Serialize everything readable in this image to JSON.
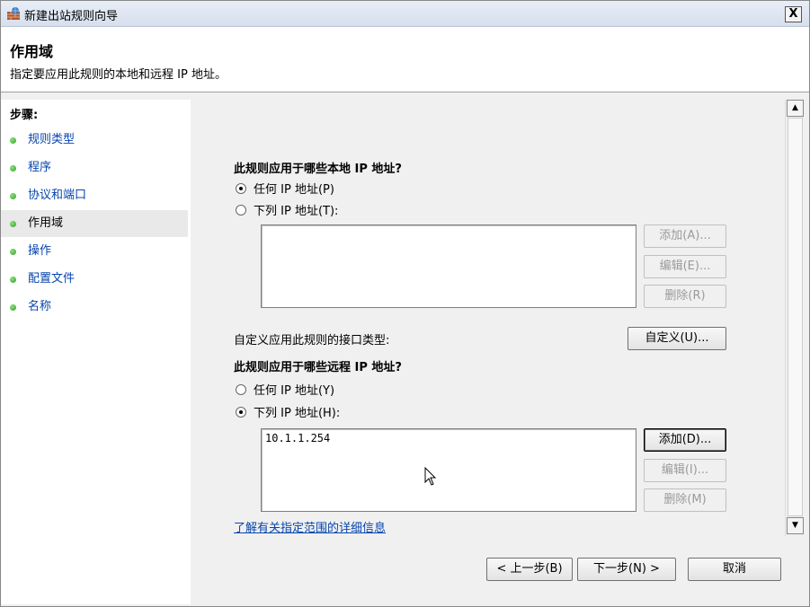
{
  "window": {
    "title": "新建出站规则向导",
    "close_label": "X"
  },
  "header": {
    "title": "作用域",
    "description": "指定要应用此规则的本地和远程 IP 地址。"
  },
  "sidebar": {
    "title": "步骤:",
    "items": [
      {
        "label": "规则类型"
      },
      {
        "label": "程序"
      },
      {
        "label": "协议和端口"
      },
      {
        "label": "作用域"
      },
      {
        "label": "操作"
      },
      {
        "label": "配置文件"
      },
      {
        "label": "名称"
      }
    ]
  },
  "local": {
    "question": "此规则应用于哪些本地 IP 地址?",
    "any_label": "任何 IP 地址(P)",
    "list_label": "下列 IP 地址(T):",
    "add_label": "添加(A)...",
    "edit_label": "编辑(E)...",
    "remove_label": "删除(R)"
  },
  "interface": {
    "label": "自定义应用此规则的接口类型:",
    "button_label": "自定义(U)..."
  },
  "remote": {
    "question": "此规则应用于哪些远程 IP 地址?",
    "any_label": "任何 IP 地址(Y)",
    "list_label": "下列 IP 地址(H):",
    "entries": [
      "10.1.1.254"
    ],
    "add_label": "添加(D)...",
    "edit_label": "编辑(I)...",
    "remove_label": "删除(M)"
  },
  "help_link": "了解有关指定范围的详细信息",
  "footer": {
    "back_label": "< 上一步(B)",
    "next_label": "下一步(N) >",
    "cancel_label": "取消"
  },
  "selected_step": "作用域",
  "local_selected": "任何 IP 地址(P)",
  "remote_selected": "下列 IP 地址(H):"
}
